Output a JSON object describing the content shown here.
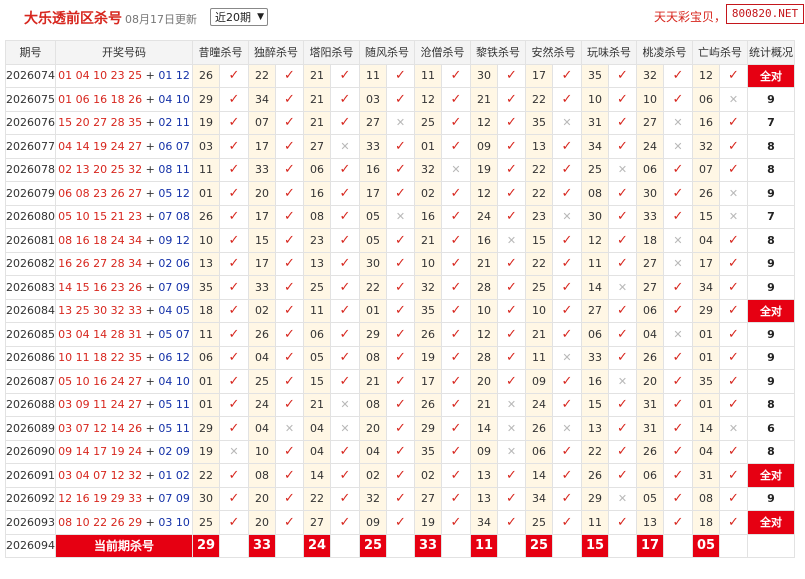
{
  "header": {
    "title": "大乐透前区杀号",
    "update_text": "08月17日更新",
    "period_select": "近20期",
    "slogan": "天天彩宝贝，",
    "brand": "800820.NET"
  },
  "table": {
    "headers": [
      "期号",
      "开奖号码",
      "昔曈杀号",
      "独醉杀号",
      "塔阳杀号",
      "随风杀号",
      "沧僧杀号",
      "黎铁杀号",
      "安然杀号",
      "玩味杀号",
      "桃凌杀号",
      "亡屿杀号",
      "统计概况"
    ],
    "rows": [
      {
        "issue": "2026074",
        "front": "01 04 10 23 25",
        "back": "01 12",
        "kills": [
          "26",
          "22",
          "21",
          "11",
          "11",
          "30",
          "17",
          "35",
          "32",
          "12"
        ],
        "hits": [
          1,
          1,
          1,
          1,
          1,
          1,
          1,
          1,
          1,
          1
        ],
        "stat": "全对",
        "full": true
      },
      {
        "issue": "2026075",
        "front": "01 06 16 18 26",
        "back": "04 10",
        "kills": [
          "29",
          "34",
          "21",
          "03",
          "12",
          "21",
          "22",
          "10",
          "10",
          "06"
        ],
        "hits": [
          1,
          1,
          1,
          1,
          1,
          1,
          1,
          1,
          1,
          0
        ],
        "stat": "9",
        "full": false
      },
      {
        "issue": "2026076",
        "front": "15 20 27 28 35",
        "back": "02 11",
        "kills": [
          "19",
          "07",
          "21",
          "27",
          "25",
          "12",
          "35",
          "31",
          "27",
          "16"
        ],
        "hits": [
          1,
          1,
          1,
          0,
          1,
          1,
          0,
          1,
          0,
          1
        ],
        "stat": "7",
        "full": false
      },
      {
        "issue": "2026077",
        "front": "04 14 19 24 27",
        "back": "06 07",
        "kills": [
          "03",
          "17",
          "27",
          "33",
          "01",
          "09",
          "13",
          "34",
          "24",
          "32"
        ],
        "hits": [
          1,
          1,
          0,
          1,
          1,
          1,
          1,
          1,
          0,
          1
        ],
        "stat": "8",
        "full": false
      },
      {
        "issue": "2026078",
        "front": "02 13 20 25 32",
        "back": "08 11",
        "kills": [
          "11",
          "33",
          "06",
          "16",
          "32",
          "19",
          "22",
          "25",
          "06",
          "07"
        ],
        "hits": [
          1,
          1,
          1,
          1,
          0,
          1,
          1,
          0,
          1,
          1
        ],
        "stat": "8",
        "full": false
      },
      {
        "issue": "2026079",
        "front": "06 08 23 26 27",
        "back": "05 12",
        "kills": [
          "01",
          "20",
          "16",
          "17",
          "02",
          "12",
          "22",
          "08",
          "30",
          "26"
        ],
        "hits": [
          1,
          1,
          1,
          1,
          1,
          1,
          1,
          1,
          1,
          0
        ],
        "stat": "9",
        "full": false
      },
      {
        "issue": "2026080",
        "front": "05 10 15 21 23",
        "back": "07 08",
        "kills": [
          "26",
          "17",
          "08",
          "05",
          "16",
          "24",
          "23",
          "30",
          "33",
          "15"
        ],
        "hits": [
          1,
          1,
          1,
          0,
          1,
          1,
          0,
          1,
          1,
          0
        ],
        "stat": "7",
        "full": false
      },
      {
        "issue": "2026081",
        "front": "08 16 18 24 34",
        "back": "09 12",
        "kills": [
          "10",
          "15",
          "23",
          "05",
          "21",
          "16",
          "15",
          "12",
          "18",
          "04"
        ],
        "hits": [
          1,
          1,
          1,
          1,
          1,
          0,
          1,
          1,
          0,
          1
        ],
        "stat": "8",
        "full": false
      },
      {
        "issue": "2026082",
        "front": "16 26 27 28 34",
        "back": "02 06",
        "kills": [
          "13",
          "17",
          "13",
          "30",
          "10",
          "21",
          "22",
          "11",
          "27",
          "17"
        ],
        "hits": [
          1,
          1,
          1,
          1,
          1,
          1,
          1,
          1,
          0,
          1
        ],
        "stat": "9",
        "full": false
      },
      {
        "issue": "2026083",
        "front": "14 15 16 23 26",
        "back": "07 09",
        "kills": [
          "35",
          "33",
          "25",
          "22",
          "32",
          "28",
          "25",
          "14",
          "27",
          "34"
        ],
        "hits": [
          1,
          1,
          1,
          1,
          1,
          1,
          1,
          0,
          1,
          1
        ],
        "stat": "9",
        "full": false
      },
      {
        "issue": "2026084",
        "front": "13 25 30 32 33",
        "back": "04 05",
        "kills": [
          "18",
          "02",
          "11",
          "01",
          "35",
          "10",
          "10",
          "27",
          "06",
          "29"
        ],
        "hits": [
          1,
          1,
          1,
          1,
          1,
          1,
          1,
          1,
          1,
          1
        ],
        "stat": "全对",
        "full": true
      },
      {
        "issue": "2026085",
        "front": "03 04 14 28 31",
        "back": "05 07",
        "kills": [
          "11",
          "26",
          "06",
          "29",
          "26",
          "12",
          "21",
          "06",
          "04",
          "01"
        ],
        "hits": [
          1,
          1,
          1,
          1,
          1,
          1,
          1,
          1,
          0,
          1
        ],
        "stat": "9",
        "full": false
      },
      {
        "issue": "2026086",
        "front": "10 11 18 22 35",
        "back": "06 12",
        "kills": [
          "06",
          "04",
          "05",
          "08",
          "19",
          "28",
          "11",
          "33",
          "26",
          "01"
        ],
        "hits": [
          1,
          1,
          1,
          1,
          1,
          1,
          0,
          1,
          1,
          1
        ],
        "stat": "9",
        "full": false
      },
      {
        "issue": "2026087",
        "front": "05 10 16 24 27",
        "back": "04 10",
        "kills": [
          "01",
          "25",
          "15",
          "21",
          "17",
          "20",
          "09",
          "16",
          "20",
          "35"
        ],
        "hits": [
          1,
          1,
          1,
          1,
          1,
          1,
          1,
          0,
          1,
          1
        ],
        "stat": "9",
        "full": false
      },
      {
        "issue": "2026088",
        "front": "03 09 11 24 27",
        "back": "05 11",
        "kills": [
          "01",
          "24",
          "21",
          "08",
          "26",
          "21",
          "24",
          "15",
          "31",
          "01"
        ],
        "hits": [
          1,
          1,
          0,
          1,
          1,
          0,
          1,
          1,
          1,
          1
        ],
        "stat": "8",
        "full": false
      },
      {
        "issue": "2026089",
        "front": "03 07 12 14 26",
        "back": "05 11",
        "kills": [
          "29",
          "04",
          "04",
          "20",
          "29",
          "14",
          "26",
          "13",
          "31",
          "14"
        ],
        "hits": [
          1,
          0,
          0,
          1,
          1,
          0,
          0,
          1,
          1,
          0
        ],
        "stat": "6",
        "full": false
      },
      {
        "issue": "2026090",
        "front": "09 14 17 19 24",
        "back": "02 09",
        "kills": [
          "19",
          "10",
          "04",
          "04",
          "35",
          "09",
          "06",
          "22",
          "26",
          "04"
        ],
        "hits": [
          0,
          1,
          1,
          1,
          1,
          0,
          1,
          1,
          1,
          1
        ],
        "stat": "8",
        "full": false
      },
      {
        "issue": "2026091",
        "front": "03 04 07 12 32",
        "back": "01 02",
        "kills": [
          "22",
          "08",
          "14",
          "02",
          "02",
          "13",
          "14",
          "26",
          "06",
          "31"
        ],
        "hits": [
          1,
          1,
          1,
          1,
          1,
          1,
          1,
          1,
          1,
          1
        ],
        "stat": "全对",
        "full": true
      },
      {
        "issue": "2026092",
        "front": "12 16 19 29 33",
        "back": "07 09",
        "kills": [
          "30",
          "20",
          "22",
          "32",
          "27",
          "13",
          "34",
          "29",
          "05",
          "08"
        ],
        "hits": [
          1,
          1,
          1,
          1,
          1,
          1,
          1,
          0,
          1,
          1
        ],
        "stat": "9",
        "full": false
      },
      {
        "issue": "2026093",
        "front": "08 10 22 26 29",
        "back": "03 10",
        "kills": [
          "25",
          "20",
          "27",
          "09",
          "19",
          "34",
          "25",
          "11",
          "13",
          "18"
        ],
        "hits": [
          1,
          1,
          1,
          1,
          1,
          1,
          1,
          1,
          1,
          1
        ],
        "stat": "全对",
        "full": true
      }
    ],
    "current": {
      "issue": "2026094",
      "label": "当前期杀号",
      "kills": [
        "29",
        "33",
        "24",
        "25",
        "33",
        "11",
        "25",
        "15",
        "17",
        "05"
      ]
    }
  },
  "icons": {
    "hit": "check-icon",
    "miss": "cross-icon"
  },
  "colors": {
    "accent": "#e60012",
    "blue_ball": "#1431a8",
    "red_ball": "#d7261e",
    "number_bg": "#fff7e5"
  }
}
